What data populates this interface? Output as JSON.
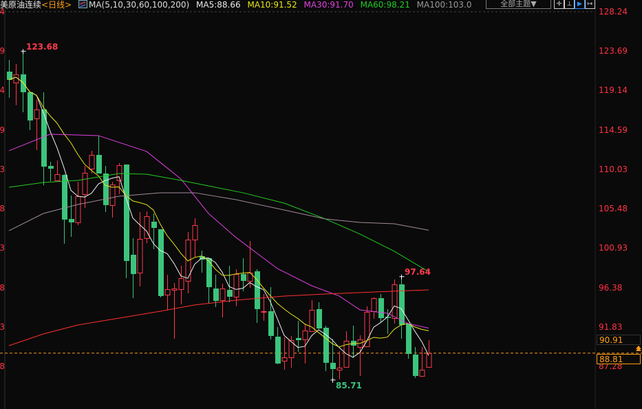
{
  "header": {
    "title": "美原油连续",
    "period": "<日线>",
    "ma_icon": "ma-chart-icon",
    "ma_params": "MA(5,10,30,60,100,200)",
    "ma_values": [
      {
        "label": "MA5:88.66",
        "color": "#e8e8e8"
      },
      {
        "label": "MA10:91.52",
        "color": "#e6e619"
      },
      {
        "label": "MA30:91.70",
        "color": "#e040e0"
      },
      {
        "label": "MA60:98.21",
        "color": "#22cc22"
      },
      {
        "label": "MA100:103.0",
        "color": "#9a9a9a"
      }
    ]
  },
  "toolbar": {
    "theme_dropdown": "全部主题▼",
    "buttons": [
      {
        "icon": "crosshair-icon",
        "glyph": "✛"
      },
      {
        "icon": "range-select-icon",
        "glyph": "⊥"
      },
      {
        "icon": "play-icon",
        "glyph": "▶",
        "active": true
      },
      {
        "icon": "shift-right-icon",
        "glyph": "↦"
      }
    ]
  },
  "price_boxes": {
    "high_low_ref": "90.91",
    "last": "88.81"
  },
  "colors": {
    "up": "#ff3a4c",
    "down": "#3cc47c",
    "last_line": "#ff9a1a",
    "background": "#0a0a0a"
  },
  "chart_data": {
    "type": "candlestick",
    "title": "",
    "y_axis": {
      "position": "right",
      "ticks": [
        "128.24",
        "123.69",
        "119.14",
        "114.59",
        "110.03",
        "105.48",
        "100.93",
        "96.38",
        "91.83",
        "87.28"
      ],
      "ylim": [
        86.0,
        128.24
      ]
    },
    "annotations": {
      "max": "123.68",
      "min": "85.71",
      "local_high": "97.64"
    },
    "last_price": 88.81,
    "candles_ohlc": [
      [
        121.32,
        122.67,
        118.3,
        120.37
      ],
      [
        120.05,
        122.2,
        117.43,
        121.0
      ],
      [
        121.0,
        123.68,
        116.63,
        118.94
      ],
      [
        118.94,
        119.0,
        114.56,
        115.68
      ],
      [
        115.91,
        118.06,
        112.26,
        116.95
      ],
      [
        116.95,
        118.94,
        108.2,
        110.35
      ],
      [
        110.43,
        110.9,
        108.68,
        110.11
      ],
      [
        108.76,
        111.06,
        108.6,
        109.47
      ],
      [
        109.39,
        109.47,
        101.44,
        104.23
      ],
      [
        104.3,
        107.01,
        102.24,
        103.91
      ],
      [
        103.91,
        108.6,
        103.59,
        106.93
      ],
      [
        107.17,
        110.43,
        105.58,
        109.63
      ],
      [
        110.11,
        112.18,
        109.55,
        111.7
      ],
      [
        111.7,
        113.93,
        109.55,
        109.55
      ],
      [
        109.55,
        110.43,
        105.1,
        105.9
      ],
      [
        105.9,
        108.6,
        104.46,
        108.28
      ],
      [
        108.76,
        110.75,
        107.17,
        110.51
      ],
      [
        110.59,
        110.59,
        97.47,
        99.45
      ],
      [
        100.17,
        102.08,
        95.16,
        97.94
      ],
      [
        98.1,
        105.1,
        96.51,
        102.0
      ],
      [
        102.08,
        105.18,
        101.52,
        104.62
      ],
      [
        103.99,
        104.94,
        100.81,
        103.27
      ],
      [
        103.11,
        103.11,
        95.24,
        95.4
      ],
      [
        95.56,
        97.86,
        93.73,
        96.19
      ],
      [
        96.11,
        96.91,
        90.47,
        96.27
      ],
      [
        96.19,
        98.9,
        94.44,
        97.47
      ],
      [
        97.15,
        102.79,
        95.72,
        101.92
      ],
      [
        101.92,
        104.38,
        99.85,
        103.59
      ],
      [
        100.01,
        100.65,
        98.1,
        99.61
      ],
      [
        99.77,
        99.77,
        94.52,
        96.43
      ],
      [
        96.27,
        97.86,
        94.13,
        94.84
      ],
      [
        94.92,
        96.83,
        92.93,
        96.27
      ],
      [
        96.11,
        98.9,
        94.68,
        95.32
      ],
      [
        95.32,
        98.5,
        94.21,
        97.94
      ],
      [
        97.94,
        99.77,
        95.95,
        97.15
      ],
      [
        97.15,
        101.76,
        96.35,
        98.1
      ],
      [
        98.26,
        98.5,
        92.3,
        93.89
      ],
      [
        93.57,
        95.64,
        92.54,
        93.65
      ],
      [
        93.65,
        96.43,
        90.39,
        90.79
      ],
      [
        90.71,
        91.82,
        87.53,
        87.61
      ],
      [
        87.92,
        90.63,
        86.89,
        88.32
      ],
      [
        88.32,
        90.79,
        87.13,
        90.31
      ],
      [
        90.55,
        92.54,
        88.96,
        90.31
      ],
      [
        90.39,
        92.14,
        87.61,
        91.42
      ],
      [
        91.34,
        94.92,
        91.26,
        93.81
      ],
      [
        93.89,
        94.68,
        91.58,
        91.66
      ],
      [
        91.74,
        91.98,
        86.73,
        87.69
      ],
      [
        87.69,
        90.47,
        85.71,
        86.97
      ],
      [
        86.89,
        89.04,
        85.78,
        87.13
      ],
      [
        87.21,
        91.34,
        87.21,
        90.23
      ],
      [
        90.23,
        91.98,
        88.24,
        89.67
      ],
      [
        89.51,
        90.87,
        86.17,
        90.39
      ],
      [
        89.59,
        94.21,
        89.59,
        93.57
      ],
      [
        93.65,
        95.24,
        92.77,
        95.16
      ],
      [
        95.16,
        95.64,
        92.38,
        92.85
      ],
      [
        93.01,
        93.89,
        91.03,
        92.93
      ],
      [
        92.85,
        97.31,
        92.22,
        96.75
      ],
      [
        96.75,
        97.64,
        90.47,
        92.06
      ],
      [
        92.22,
        92.22,
        88.16,
        88.72
      ],
      [
        88.64,
        89.51,
        85.94,
        86.17
      ],
      [
        86.17,
        89.51,
        86.17,
        86.89
      ],
      [
        87.21,
        90.31,
        87.21,
        88.81
      ]
    ],
    "moving_averages": [
      {
        "name": "MA5",
        "period": 5,
        "color": "#f0f0f0"
      },
      {
        "name": "MA10",
        "period": 10,
        "color": "#e6e619"
      },
      {
        "name": "MA30",
        "color": "#e040e0",
        "points": [
          [
            0,
            112.18
          ],
          [
            6,
            114.09
          ],
          [
            13,
            113.93
          ],
          [
            20,
            112.1
          ],
          [
            25,
            108.92
          ],
          [
            29,
            104.94
          ],
          [
            33,
            102.16
          ],
          [
            39,
            98.58
          ],
          [
            44,
            96.59
          ],
          [
            48,
            95.4
          ],
          [
            51,
            93.81
          ],
          [
            55,
            93.41
          ],
          [
            58,
            92.22
          ],
          [
            61,
            91.7
          ]
        ]
      },
      {
        "name": "MA60",
        "color": "#22cc22",
        "points": [
          [
            0,
            107.96
          ],
          [
            5,
            108.52
          ],
          [
            10,
            108.76
          ],
          [
            16,
            109.55
          ],
          [
            20,
            109.47
          ],
          [
            25,
            108.76
          ],
          [
            29,
            108.12
          ],
          [
            34,
            107.33
          ],
          [
            40,
            106.13
          ],
          [
            46,
            104.3
          ],
          [
            51,
            102.56
          ],
          [
            56,
            100.57
          ],
          [
            61,
            98.21
          ]
        ]
      },
      {
        "name": "MA100",
        "color": "#a08a9a",
        "points": [
          [
            0,
            102.95
          ],
          [
            5,
            104.94
          ],
          [
            10,
            105.97
          ],
          [
            16,
            106.93
          ],
          [
            22,
            107.33
          ],
          [
            27,
            107.33
          ],
          [
            33,
            106.53
          ],
          [
            40,
            105.34
          ],
          [
            46,
            104.3
          ],
          [
            51,
            103.91
          ],
          [
            56,
            103.75
          ],
          [
            61,
            103.0
          ]
        ]
      },
      {
        "name": "MA200",
        "color": "#ff3030",
        "points": [
          [
            0,
            89.67
          ],
          [
            5,
            91.02
          ],
          [
            10,
            92.06
          ],
          [
            16,
            92.85
          ],
          [
            22,
            93.65
          ],
          [
            27,
            94.37
          ],
          [
            33,
            94.92
          ],
          [
            40,
            95.4
          ],
          [
            46,
            95.64
          ],
          [
            51,
            95.8
          ],
          [
            56,
            95.96
          ],
          [
            61,
            96.11
          ]
        ]
      }
    ]
  }
}
